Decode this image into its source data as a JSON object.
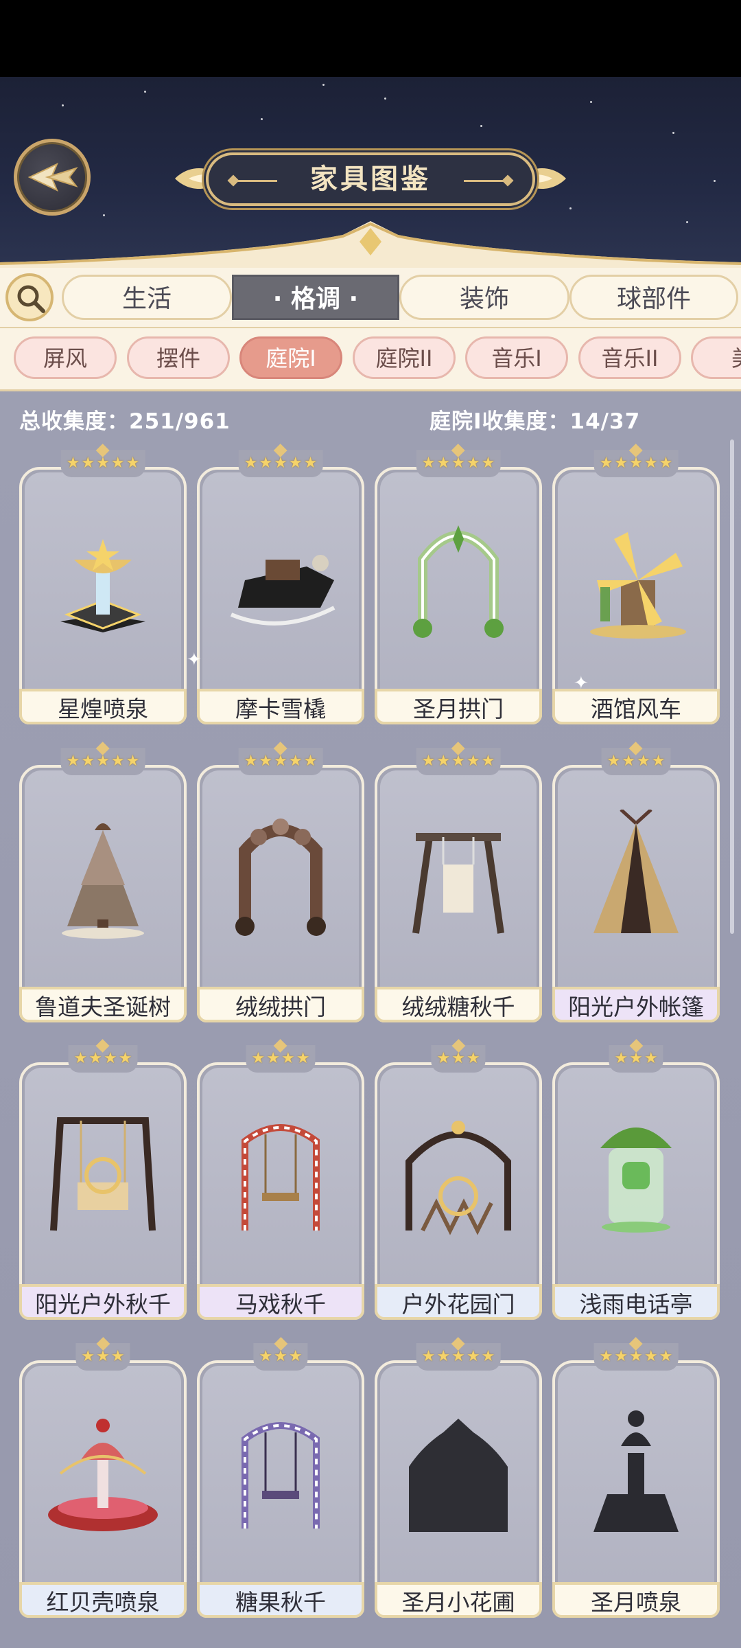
{
  "header": {
    "title": "家具图鉴",
    "back_icon": "back-arrow-icon"
  },
  "main_tabs": [
    {
      "label": "生活",
      "active": false
    },
    {
      "label": "· 格调 ·",
      "active": true
    },
    {
      "label": "装饰",
      "active": false
    },
    {
      "label": "球部件",
      "active": false
    }
  ],
  "sub_tabs": [
    {
      "label": "屏风",
      "active": false
    },
    {
      "label": "摆件",
      "active": false
    },
    {
      "label": "庭院I",
      "active": true
    },
    {
      "label": "庭院II",
      "active": false
    },
    {
      "label": "音乐I",
      "active": false
    },
    {
      "label": "音乐II",
      "active": false
    },
    {
      "label": "美",
      "active": false
    }
  ],
  "collection": {
    "total": "总收集度：251/961",
    "category": "庭院I收集度：14/37"
  },
  "colors": {
    "star": "#f5d36a",
    "active_subtab": "#e69b8c",
    "active_tab": "#6a6a72",
    "panel": "#9ea0b3"
  },
  "items": [
    {
      "name": "星煌喷泉",
      "stars": 5,
      "tier": "gold",
      "thumb": "fountain"
    },
    {
      "name": "摩卡雪橇",
      "stars": 5,
      "tier": "gold",
      "thumb": "sleigh"
    },
    {
      "name": "圣月拱门",
      "stars": 5,
      "tier": "gold",
      "thumb": "arch-green"
    },
    {
      "name": "酒馆风车",
      "stars": 5,
      "tier": "gold",
      "thumb": "windmill"
    },
    {
      "name": "鲁道夫圣诞树",
      "stars": 5,
      "tier": "gold",
      "thumb": "tree"
    },
    {
      "name": "绒绒拱门",
      "stars": 5,
      "tier": "gold",
      "thumb": "arch-brown"
    },
    {
      "name": "绒绒糖秋千",
      "stars": 5,
      "tier": "gold",
      "thumb": "swing-frame"
    },
    {
      "name": "阳光户外帐篷",
      "stars": 4,
      "tier": "purple",
      "thumb": "tent"
    },
    {
      "name": "阳光户外秋千",
      "stars": 4,
      "tier": "purple",
      "thumb": "swing-sun"
    },
    {
      "name": "马戏秋千",
      "stars": 4,
      "tier": "purple",
      "thumb": "swing-circus"
    },
    {
      "name": "户外花园门",
      "stars": 3,
      "tier": "blue",
      "thumb": "garden-gate"
    },
    {
      "name": "浅雨电话亭",
      "stars": 3,
      "tier": "blue",
      "thumb": "phone-booth"
    },
    {
      "name": "红贝壳喷泉",
      "stars": 3,
      "tier": "blue",
      "thumb": "shell-fountain"
    },
    {
      "name": "糖果秋千",
      "stars": 3,
      "tier": "blue",
      "thumb": "swing-candy"
    },
    {
      "name": "圣月小花圃",
      "stars": 5,
      "tier": "gold",
      "thumb": "silhouette-garden"
    },
    {
      "name": "圣月喷泉",
      "stars": 5,
      "tier": "gold",
      "thumb": "silhouette-fountain"
    }
  ]
}
